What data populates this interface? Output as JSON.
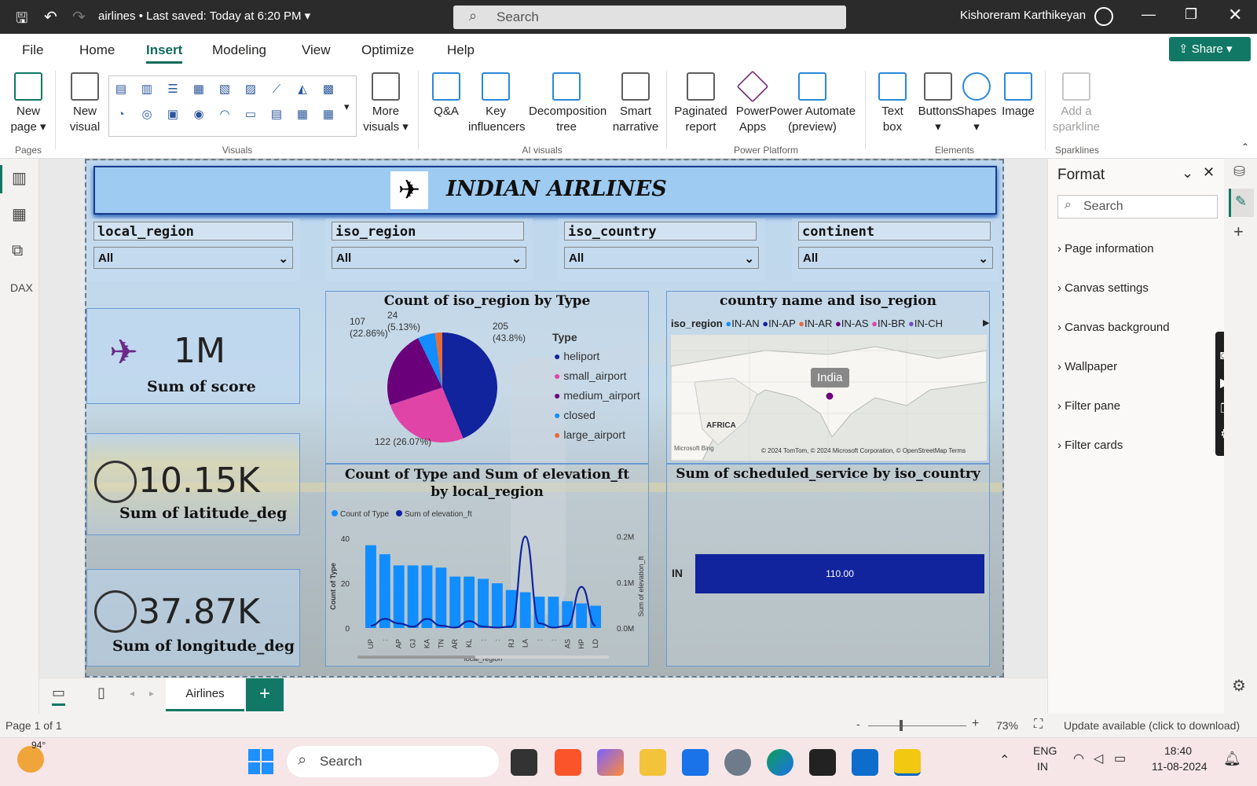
{
  "window": {
    "file": "airlines",
    "saved": "Last saved: Today at 6:20 PM",
    "search_placeholder": "Search",
    "user": "Kishoreram Karthikeyan"
  },
  "menu": [
    "File",
    "Home",
    "Insert",
    "Modeling",
    "View",
    "Optimize",
    "Help"
  ],
  "share": "Share",
  "ribbon": {
    "pages": {
      "new_page": "New page",
      "group": "Pages"
    },
    "visuals": {
      "new_visual": "New visual",
      "more": "More visuals",
      "group": "Visuals"
    },
    "ai": {
      "qa": "Q&A",
      "key": "Key influencers",
      "decomp": "Decomposition tree",
      "smart": "Smart narrative",
      "group": "AI visuals"
    },
    "platform": {
      "paginated": "Paginated report",
      "apps": "Power Apps",
      "automate": "Power Automate (preview)",
      "group": "Power Platform"
    },
    "elements": {
      "textbox": "Text box",
      "buttons": "Buttons",
      "shapes": "Shapes",
      "image": "Image",
      "group": "Elements"
    },
    "sparklines": {
      "add": "Add a sparkline",
      "group": "Sparklines"
    }
  },
  "report": {
    "title": "INDIAN AIRLINES",
    "slicers": [
      {
        "title": "local_region",
        "value": "All"
      },
      {
        "title": "iso_region",
        "value": "All"
      },
      {
        "title": "iso_country",
        "value": "All"
      },
      {
        "title": "continent",
        "value": "All"
      }
    ],
    "kpis": [
      {
        "value": "1M",
        "label": "Sum of score"
      },
      {
        "value": "10.15K",
        "label": "Sum of latitude_deg"
      },
      {
        "value": "37.87K",
        "label": "Sum of longitude_deg"
      }
    ],
    "map": {
      "title": "country name and iso_region",
      "legend_title": "iso_region",
      "legend": [
        {
          "name": "IN-AN",
          "color": "#118dff"
        },
        {
          "name": "IN-AP",
          "color": "#12239e"
        },
        {
          "name": "IN-AR",
          "color": "#e66c37"
        },
        {
          "name": "IN-AS",
          "color": "#6b007b"
        },
        {
          "name": "IN-BR",
          "color": "#e044a7"
        },
        {
          "name": "IN-CH",
          "color": "#744ec2"
        }
      ],
      "tooltip": "India",
      "label_africa": "AFRICA",
      "bing": "Microsoft Bing",
      "credits": "© 2024 TomTom, © 2024 Microsoft Corporation, © OpenStreetMap  Terms"
    },
    "bar": {
      "title": "Sum of scheduled_service by iso_country",
      "category": "IN",
      "value_label": "110.00"
    }
  },
  "chart_data": [
    {
      "type": "pie",
      "title": "Count of iso_region by Type",
      "legend_title": "Type",
      "slices": [
        {
          "name": "heliport",
          "value": 205,
          "label": "205",
          "pct": "(43.8%)",
          "color": "#12239e"
        },
        {
          "name": "small_airport",
          "value": 122,
          "label": "122 (26.07%)",
          "color": "#e044a7"
        },
        {
          "name": "medium_airport",
          "value": 107,
          "label": "107",
          "pct": "(22.86%)",
          "color": "#6b007b"
        },
        {
          "name": "closed",
          "value": 24,
          "label": "24",
          "pct": "(5.13%)",
          "color": "#118dff"
        },
        {
          "name": "large_airport",
          "value": 10,
          "color": "#e66c37"
        }
      ]
    },
    {
      "type": "bar",
      "title": "Count of Type and Sum of elevation_ft by local_region",
      "xlabel": "local_region",
      "ylabel": "Count of Type",
      "y2label": "Sum of elevation_ft",
      "categories": [
        "UP",
        "",
        "AP",
        "GJ",
        "KA",
        "TN",
        "AR",
        "KL",
        "",
        "",
        "RJ",
        "LA",
        "",
        "",
        "AS",
        "HP",
        "LD"
      ],
      "y_ticks": [
        "0",
        "20",
        "40"
      ],
      "y2_ticks": [
        "0.0M",
        "0.1M",
        "0.2M"
      ],
      "ylim": [
        0,
        45
      ],
      "y2lim": [
        0,
        0.22
      ],
      "series": [
        {
          "name": "Count of Type",
          "type": "bar",
          "color": "#118dff",
          "values": [
            37,
            33,
            28,
            28,
            28,
            27,
            23,
            23,
            22,
            20,
            17,
            16,
            14,
            14,
            12,
            11,
            10
          ]
        },
        {
          "name": "Sum of elevation_ft",
          "type": "line",
          "color": "#12239e",
          "values": [
            0.005,
            0.02,
            0.01,
            0.003,
            0.02,
            0.005,
            0.001,
            0.015,
            0.003,
            0.001,
            0.003,
            0.2,
            0.01,
            0.001,
            0.005,
            0.09,
            0.005
          ]
        }
      ]
    }
  ],
  "pages": {
    "tab": "Airlines",
    "count": "Page 1 of 1"
  },
  "format_pane": {
    "title": "Format",
    "search": "Search",
    "items": [
      "Page information",
      "Canvas settings",
      "Canvas background",
      "Wallpaper",
      "Filter pane",
      "Filter cards"
    ]
  },
  "status": {
    "zoom": "73%",
    "update": "Update available (click to download)"
  },
  "taskbar": {
    "weather": "94°",
    "search": "Search",
    "lang1": "ENG",
    "lang2": "IN",
    "time": "18:40",
    "date": "11-08-2024"
  }
}
